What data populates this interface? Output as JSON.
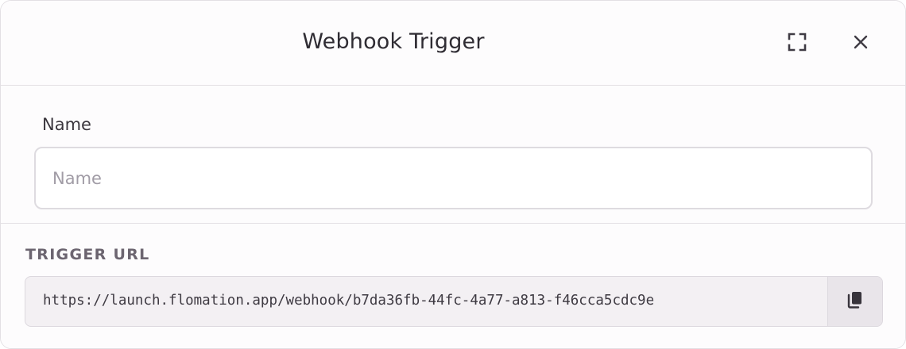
{
  "dialog": {
    "title": "Webhook Trigger",
    "expand_icon": "expand-icon",
    "close_icon": "close-icon"
  },
  "name_field": {
    "label": "Name",
    "placeholder": "Name",
    "value": ""
  },
  "trigger_url": {
    "label": "TRIGGER URL",
    "url": "https://launch.flomation.app/webhook/b7da36fb-44fc-4a77-a813-f46cca5cdc9e",
    "copy_icon": "copy-icon"
  },
  "colors": {
    "title_text": "#2f2c33",
    "border": "#e3e0e4",
    "url_box_background": "#f3f0f3",
    "section_label": "#6c6570"
  }
}
